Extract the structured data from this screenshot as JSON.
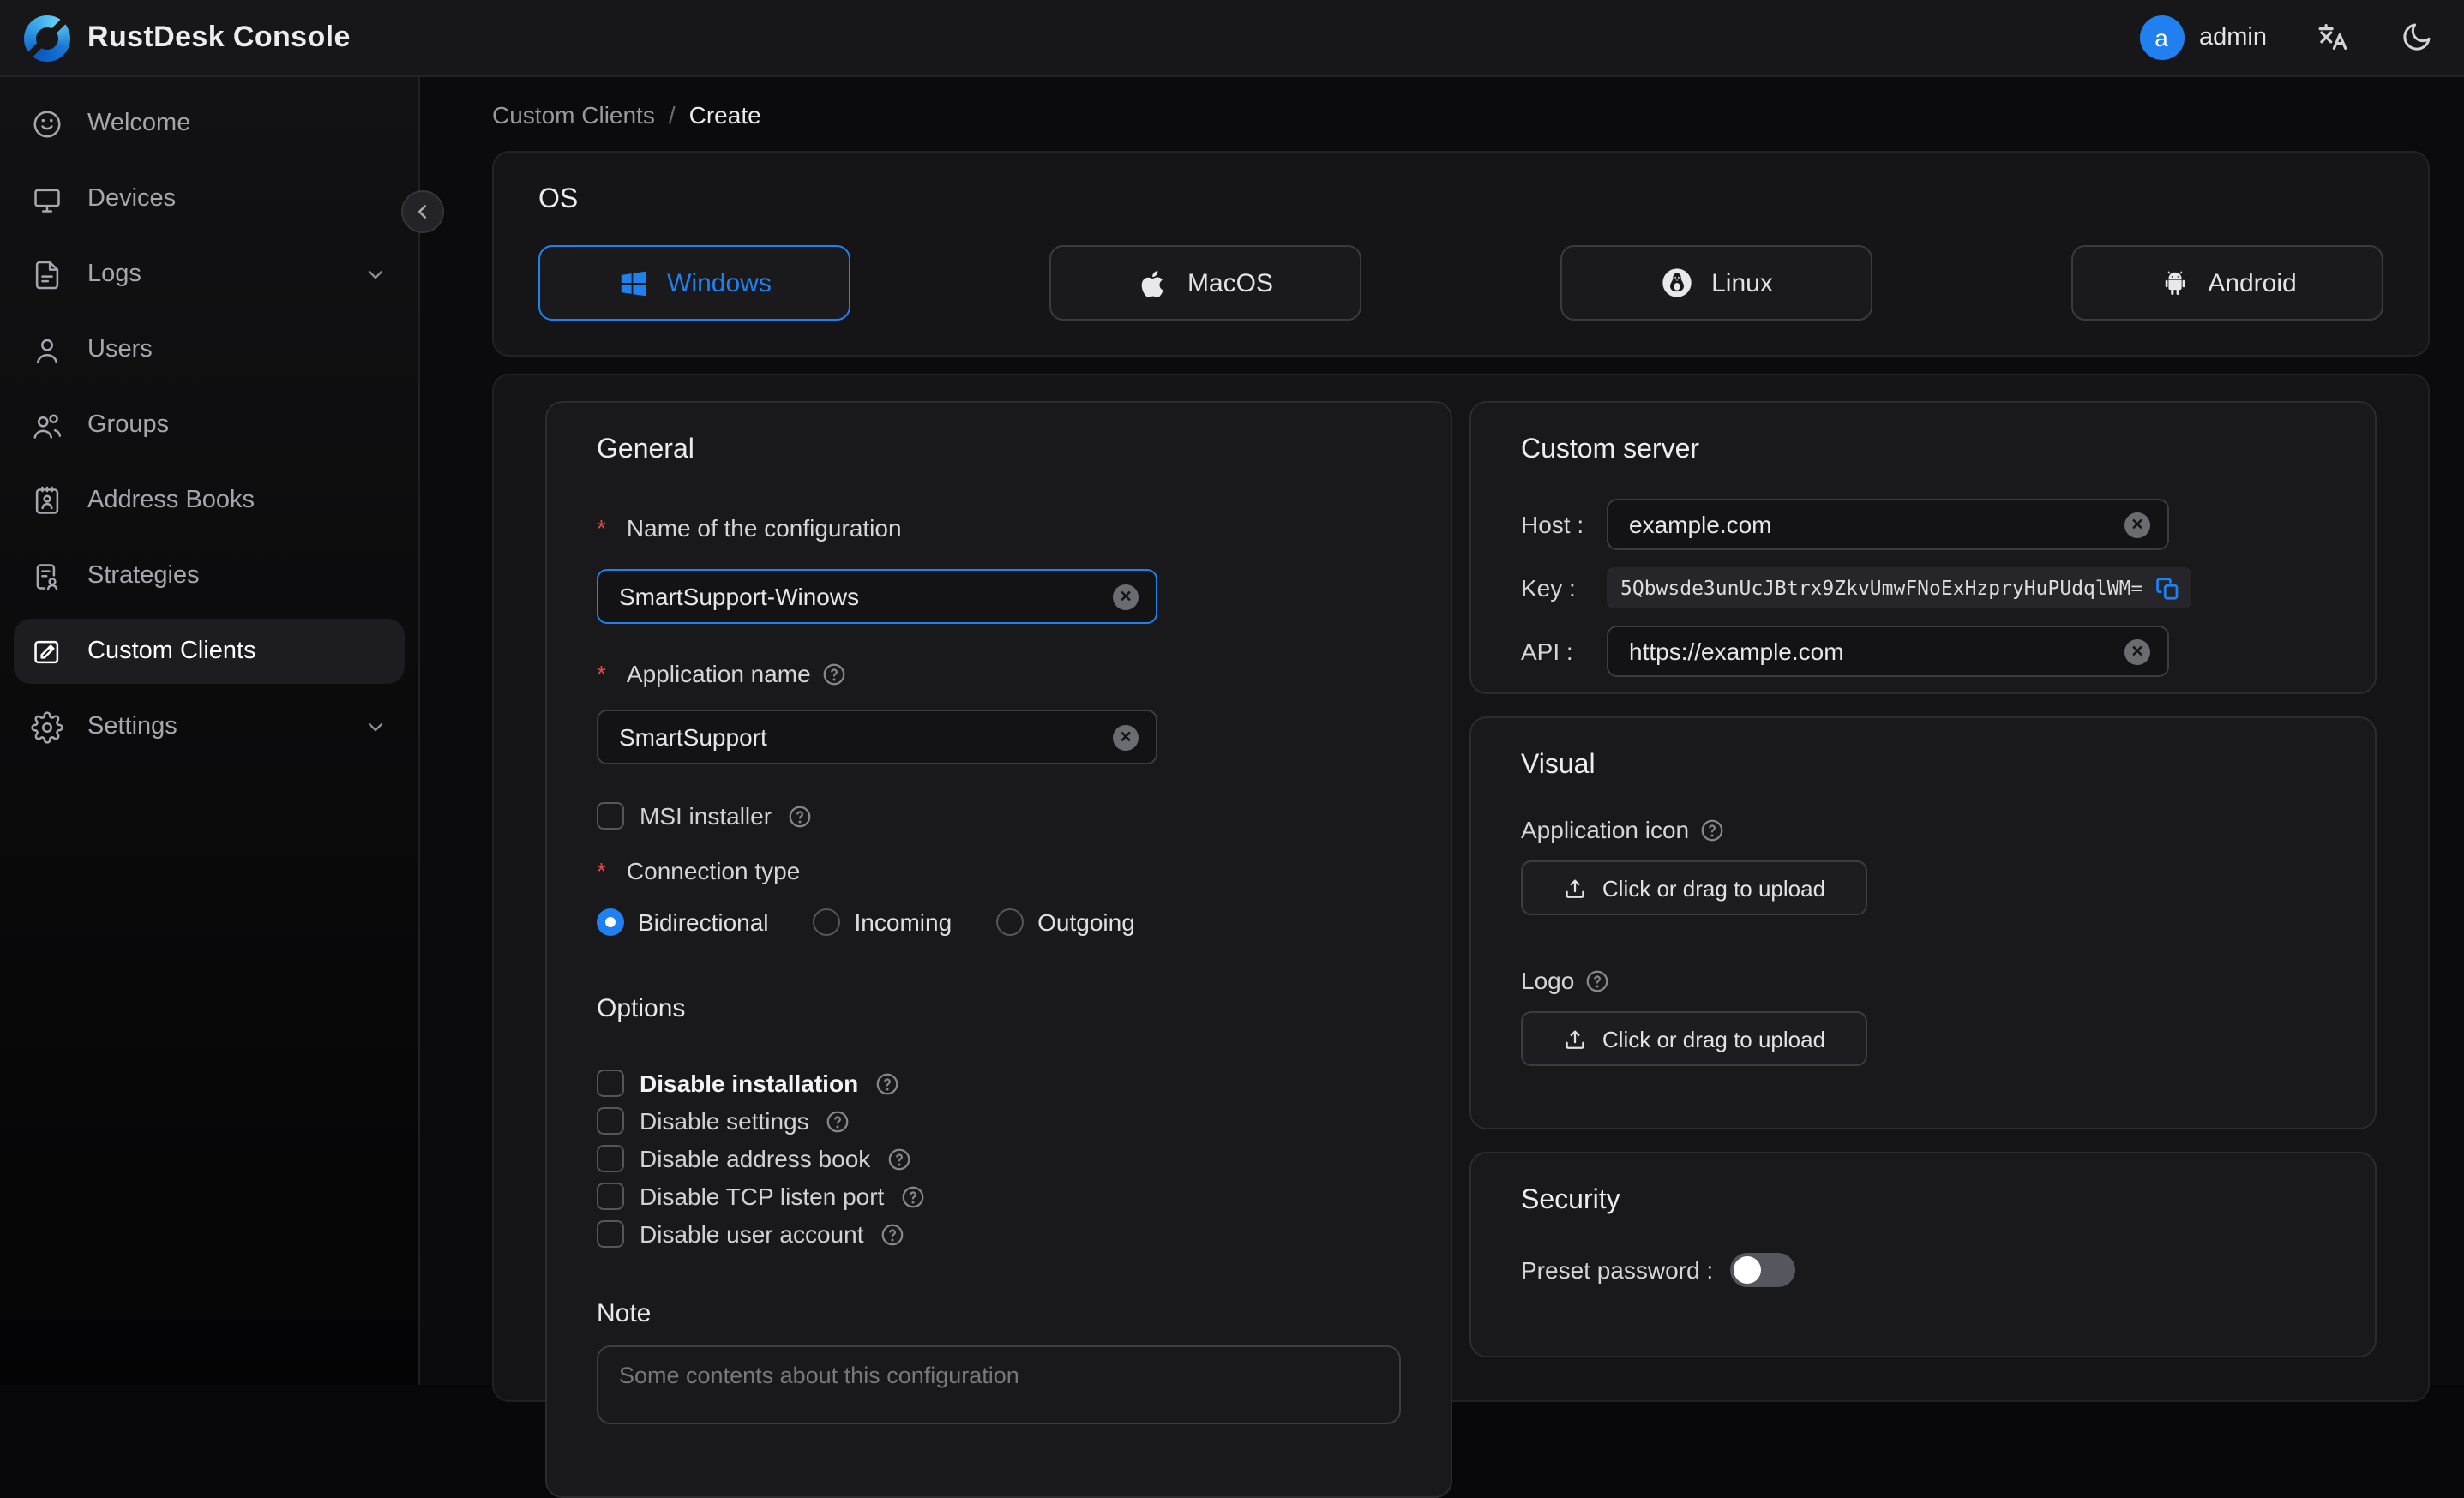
{
  "colors": {
    "accent": "#2080f0",
    "required_mark": "#e14848"
  },
  "header": {
    "title": "RustDesk Console",
    "user_initial": "a",
    "user_name": "admin"
  },
  "sidebar": {
    "items": [
      {
        "label": "Welcome"
      },
      {
        "label": "Devices"
      },
      {
        "label": "Logs",
        "expandable": true
      },
      {
        "label": "Users"
      },
      {
        "label": "Groups"
      },
      {
        "label": "Address Books"
      },
      {
        "label": "Strategies"
      },
      {
        "label": "Custom Clients",
        "active": true
      },
      {
        "label": "Settings",
        "expandable": true
      }
    ]
  },
  "breadcrumb": {
    "parent": "Custom Clients",
    "separator": "/",
    "current": "Create"
  },
  "os": {
    "title": "OS",
    "options": [
      {
        "label": "Windows",
        "selected": true
      },
      {
        "label": "MacOS",
        "selected": false
      },
      {
        "label": "Linux",
        "selected": false
      },
      {
        "label": "Android",
        "selected": false
      }
    ]
  },
  "general": {
    "title": "General",
    "name_label": "Name of the configuration",
    "name_value": "SmartSupport-Winows",
    "app_name_label": "Application name",
    "app_name_value": "SmartSupport",
    "msi_label": "MSI installer",
    "connection_label": "Connection type",
    "connection_options": [
      {
        "label": "Bidirectional",
        "selected": true
      },
      {
        "label": "Incoming",
        "selected": false
      },
      {
        "label": "Outgoing",
        "selected": false
      }
    ],
    "options_title": "Options",
    "options": [
      {
        "label": "Disable installation",
        "checked": false
      },
      {
        "label": "Disable settings",
        "checked": false
      },
      {
        "label": "Disable address book",
        "checked": false
      },
      {
        "label": "Disable TCP listen port",
        "checked": false
      },
      {
        "label": "Disable user account",
        "checked": false
      }
    ],
    "note_label": "Note",
    "note_placeholder": "Some contents about this configuration"
  },
  "custom_server": {
    "title": "Custom server",
    "host_label": "Host :",
    "host_value": "example.com",
    "key_label": "Key :",
    "key_value": "5Qbwsde3unUcJBtrx9ZkvUmwFNoExHzpryHuPUdqlWM=",
    "api_label": "API :",
    "api_value": "https://example.com"
  },
  "visual": {
    "title": "Visual",
    "app_icon_label": "Application icon",
    "logo_label": "Logo",
    "upload_label": "Click or drag to upload"
  },
  "security": {
    "title": "Security",
    "preset_password_label": "Preset password :",
    "preset_password_on": false
  }
}
